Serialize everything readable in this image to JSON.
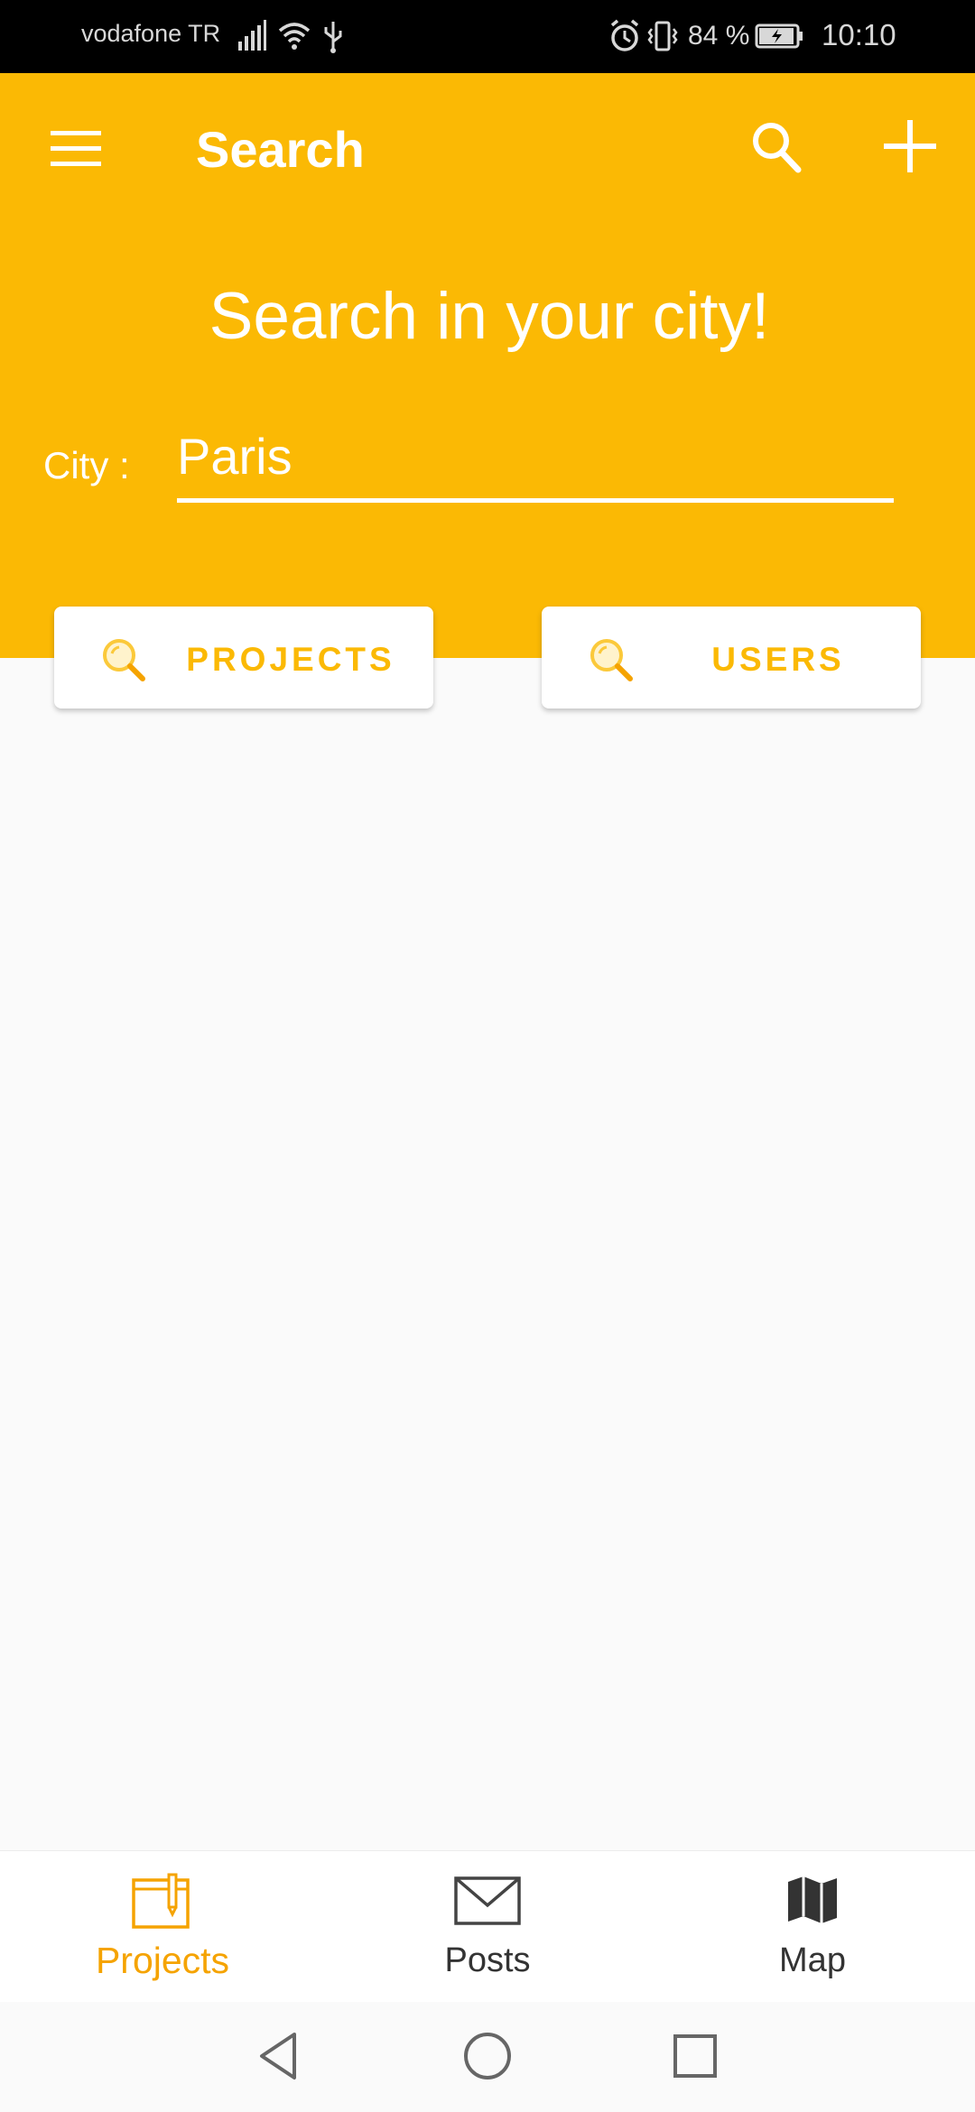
{
  "status_bar": {
    "carrier": "vodafone TR",
    "battery": "84 %",
    "time": "10:10"
  },
  "header": {
    "title": "Search",
    "headline": "Search in your city!",
    "city_label": "City :",
    "city_value": "Paris"
  },
  "buttons": {
    "projects_label": "PROJECTS",
    "users_label": "USERS"
  },
  "bottom_nav": {
    "items": [
      {
        "label": "Projects",
        "icon": "projects-icon",
        "active": true
      },
      {
        "label": "Posts",
        "icon": "envelope-icon",
        "active": false
      },
      {
        "label": "Map",
        "icon": "map-icon",
        "active": false
      }
    ]
  },
  "colors": {
    "accent": "#fbb904",
    "active_nav": "#f5a300",
    "background": "#fafafa"
  }
}
